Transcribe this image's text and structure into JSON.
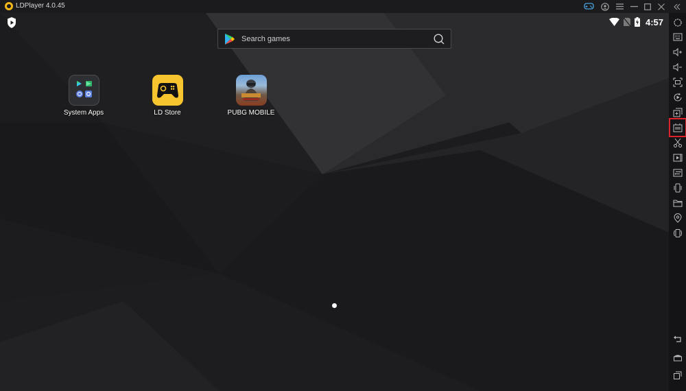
{
  "window": {
    "title": "LDPlayer 4.0.45",
    "controls": [
      {
        "name": "gamepad-icon",
        "label": "Gamepad"
      },
      {
        "name": "account-icon",
        "label": "Account"
      },
      {
        "name": "menu-icon",
        "label": "Menu"
      },
      {
        "name": "minimize-icon",
        "label": "Minimize"
      },
      {
        "name": "maximize-icon",
        "label": "Maximize"
      },
      {
        "name": "close-icon",
        "label": "Close"
      },
      {
        "name": "collapse-sidebar-icon",
        "label": "Collapse"
      }
    ]
  },
  "statusbar": {
    "time": "4:57",
    "icons": [
      "wifi-icon",
      "no-sim-icon",
      "battery-charging-icon"
    ]
  },
  "search": {
    "placeholder": "Search games"
  },
  "apps": [
    {
      "label": "System Apps",
      "icon": "system-apps-folder-icon"
    },
    {
      "label": "LD Store",
      "icon": "ld-store-icon"
    },
    {
      "label": "PUBG MOBILE",
      "icon": "pubg-mobile-icon"
    }
  ],
  "pager": {
    "current_page": 1,
    "total_pages": 1
  },
  "sidebar": {
    "items": [
      {
        "name": "settings",
        "label": "Settings"
      },
      {
        "name": "keyboard-mapping",
        "label": "Keyboard mapping"
      },
      {
        "name": "volume-up",
        "label": "Volume up"
      },
      {
        "name": "volume-down",
        "label": "Volume down"
      },
      {
        "name": "fullscreen",
        "label": "Full screen"
      },
      {
        "name": "operation-record",
        "label": "Operation record"
      },
      {
        "name": "add-multi-instance",
        "label": "Multi-instance"
      },
      {
        "name": "install-apk",
        "label": "Install APK",
        "highlighted": true
      },
      {
        "name": "screenshot",
        "label": "Screenshot"
      },
      {
        "name": "record-video",
        "label": "Record video"
      },
      {
        "name": "sync",
        "label": "Synchronizer"
      },
      {
        "name": "shake",
        "label": "Shake"
      },
      {
        "name": "shared-folder",
        "label": "Shared folder"
      },
      {
        "name": "location",
        "label": "Virtual location"
      },
      {
        "name": "rotate",
        "label": "Rotate"
      }
    ],
    "nav": [
      {
        "name": "back",
        "label": "Back"
      },
      {
        "name": "home",
        "label": "Home"
      },
      {
        "name": "recents",
        "label": "Recent apps"
      }
    ]
  },
  "colors": {
    "highlight": "#e0222a",
    "ld_yellow": "#f6c42e"
  }
}
